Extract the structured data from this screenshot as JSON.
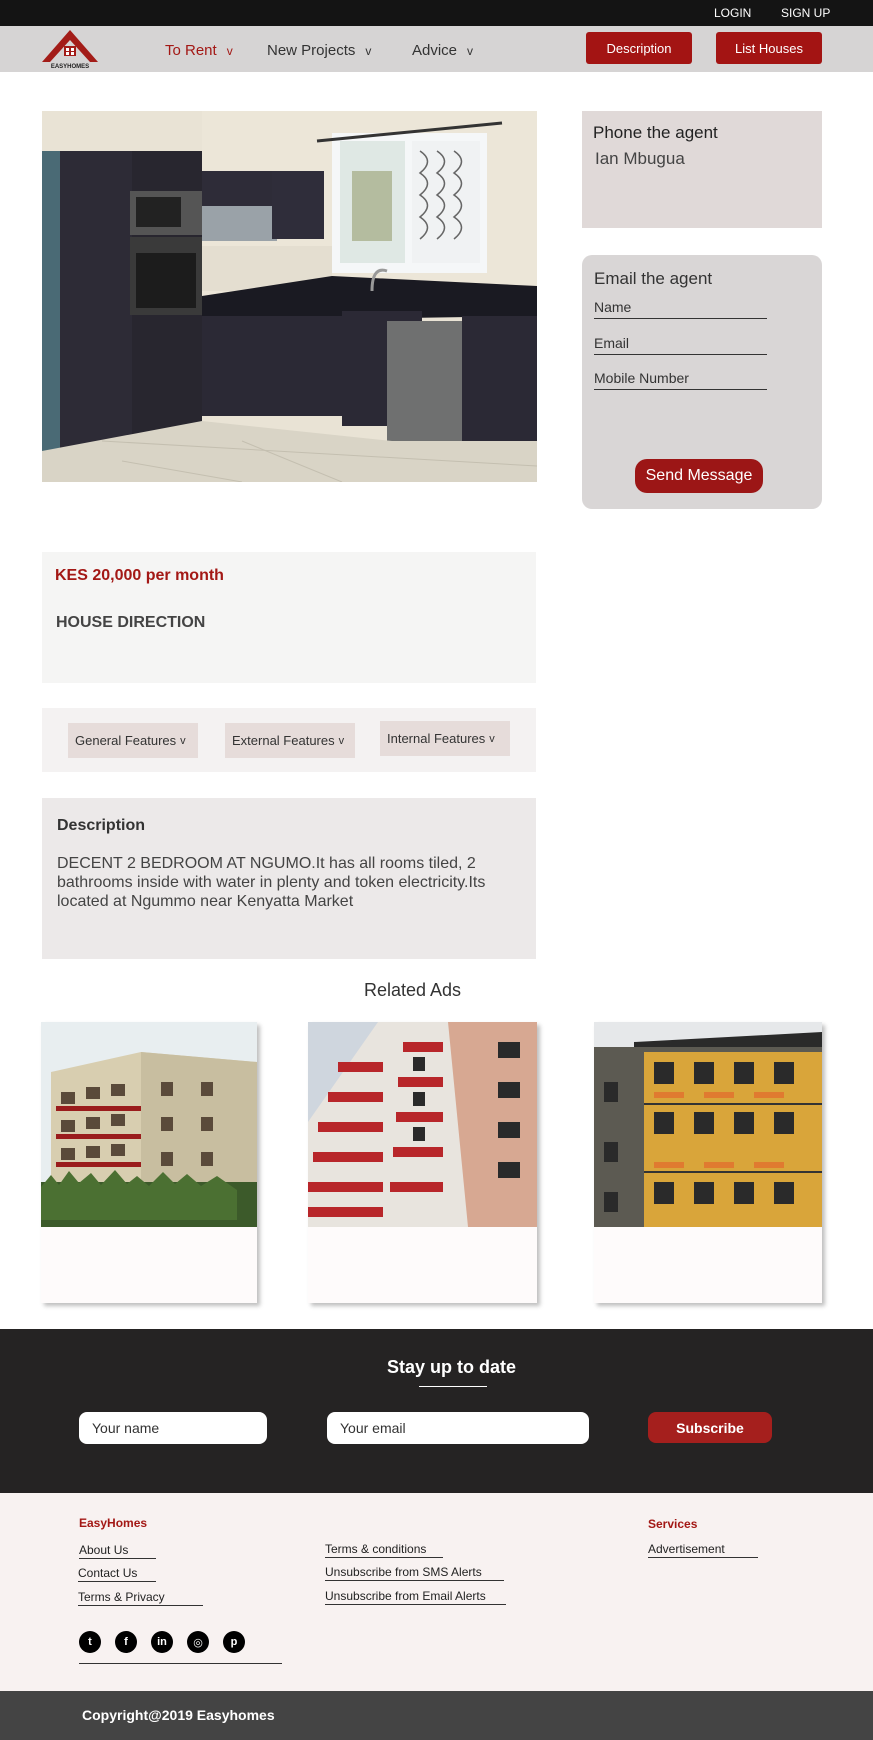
{
  "topbar": {
    "login": "LOGIN",
    "signup": "SIGN UP"
  },
  "brand": {
    "logo_text": "EASYHOMES",
    "accent": "#a31413"
  },
  "nav": {
    "items": [
      {
        "label": "To Rent",
        "chevron": "v",
        "active": true
      },
      {
        "label": "New Projects",
        "chevron": "v"
      },
      {
        "label": "Advice",
        "chevron": "v"
      }
    ],
    "description_button": "Description",
    "list_houses_button": "List Houses"
  },
  "agent": {
    "phone_heading": "Phone the agent",
    "name": "Ian Mbugua",
    "email_heading": "Email the agent",
    "fields": {
      "name": "Name",
      "email": "Email",
      "mobile": "Mobile Number"
    },
    "send_button": "Send Message"
  },
  "listing": {
    "price": "KES 20,000 per month",
    "direction_heading": "HOUSE DIRECTION",
    "features": [
      {
        "label": "General Features",
        "chevron": "v"
      },
      {
        "label": "External Features",
        "chevron": "v"
      },
      {
        "label": "Internal Features",
        "chevron": "v"
      }
    ],
    "description_heading": "Description",
    "description": "DECENT 2 BEDROOM AT NGUMO.It has all rooms tiled, 2 bathrooms inside with water in plenty and token electricity.Its located at Ngummo near Kenyatta Market"
  },
  "related": {
    "title": "Related Ads"
  },
  "newsletter": {
    "title": "Stay up to date",
    "name_placeholder": "Your name",
    "email_placeholder": "Your email",
    "subscribe_button": "Subscribe"
  },
  "footer": {
    "brand_heading": "EasyHomes",
    "col1": [
      "About Us",
      "Contact Us",
      "Terms & Privacy"
    ],
    "col2": [
      "Terms & conditions",
      "Unsubscribe from SMS Alerts",
      "Unsubscribe from Email Alerts"
    ],
    "services_heading": "Services",
    "services": [
      "Advertisement"
    ],
    "social_icons": [
      "twitter-icon",
      "facebook-icon",
      "linkedin-icon",
      "instagram-icon",
      "pinterest-icon"
    ],
    "social_glyphs": [
      "t",
      "f",
      "in",
      "◎",
      "p"
    ],
    "copyright": "Copyright@2019 Easyhomes"
  }
}
